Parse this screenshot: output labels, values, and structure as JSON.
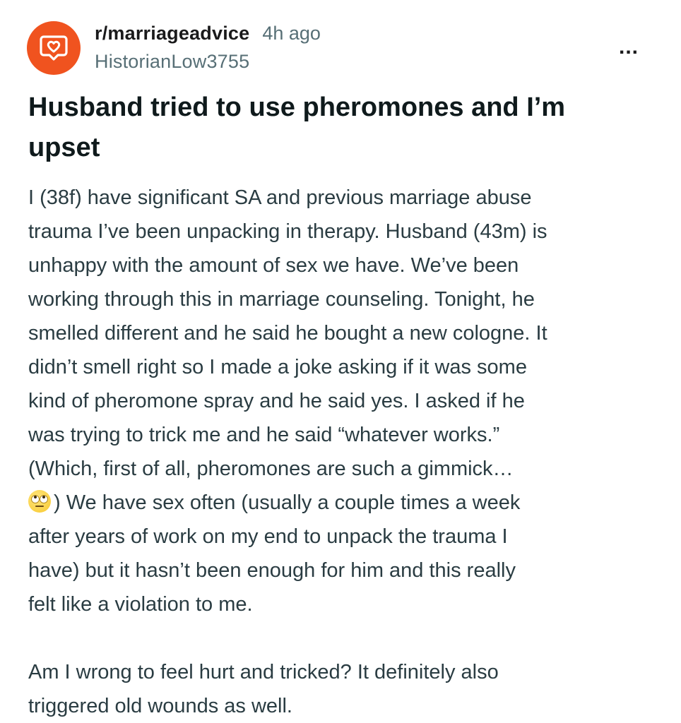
{
  "post": {
    "subreddit": "r/marriageadvice",
    "time": "4h ago",
    "username": "HistorianLow3755",
    "more_label": "...",
    "avatar_icon": "subreddit-heart-chat-icon",
    "avatar_color": "#f0531f",
    "title_lines": [
      "Husband tried to use pheromones and I’m",
      "upset"
    ],
    "body_lines": [
      "I (38f) have significant SA and previous marriage abuse",
      "trauma I’ve been unpacking in therapy. Husband (43m) is",
      "unhappy with the amount of sex we have. We’ve been",
      "working through this in marriage counseling. Tonight, he",
      "smelled different and he said he bought a new cologne. It",
      "didn’t smell right so I made a joke asking if it was some",
      "kind of pheromone spray and he said yes. I asked if he",
      "was trying to trick me and he said “whatever works.”",
      "(Which, first of all, pheromones are such a gimmick…",
      ") We have sex often (usually a couple times a week",
      "after years of work on my end to unpack the trauma I",
      "have) but it hasn’t been enough for him and this really",
      "felt like a violation to me."
    ],
    "emoji": "face-with-rolling-eyes",
    "body_lines_2": [
      "Am I wrong to feel hurt and tricked? It definitely also",
      "triggered old wounds as well."
    ]
  }
}
